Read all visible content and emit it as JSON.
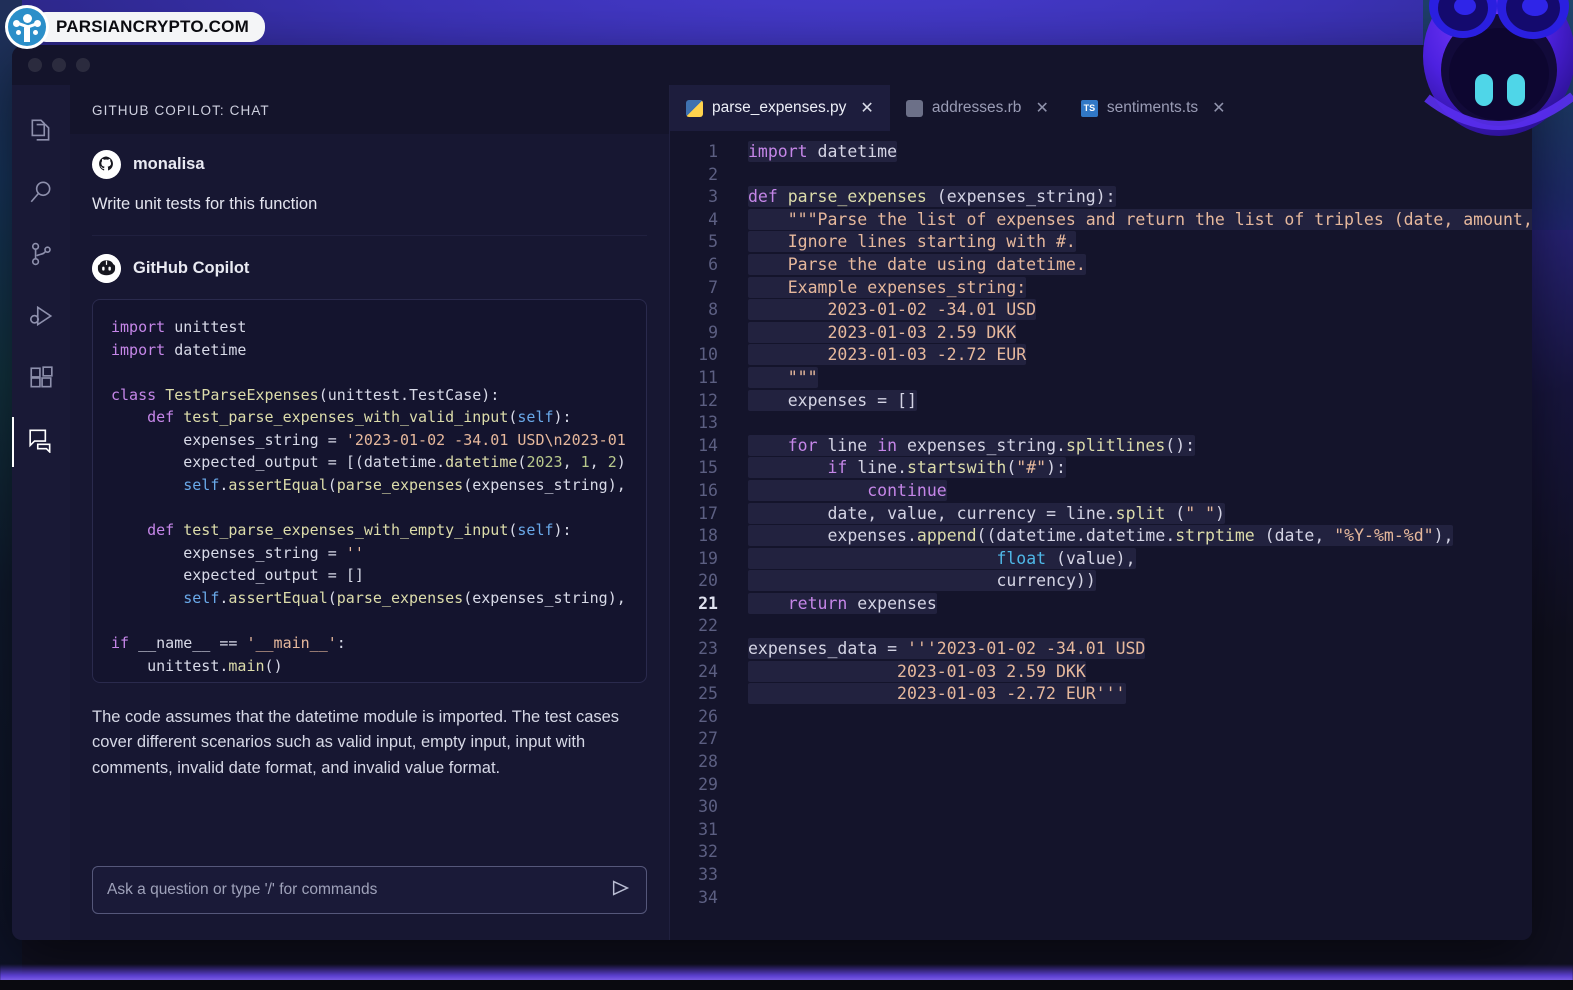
{
  "watermark": {
    "text": "PARSIANCRYPTO.COM",
    "logo_icon": "tree-network-logo-icon"
  },
  "window": {
    "traffic_lights": [
      "close",
      "minimize",
      "maximize"
    ]
  },
  "activity_bar": {
    "items": [
      {
        "name": "explorer",
        "icon": "files-icon",
        "active": false
      },
      {
        "name": "search",
        "icon": "search-icon",
        "active": false
      },
      {
        "name": "source-control",
        "icon": "source-control-icon",
        "active": false
      },
      {
        "name": "run-and-debug",
        "icon": "run-debug-icon",
        "active": false
      },
      {
        "name": "extensions",
        "icon": "extensions-icon",
        "active": false
      },
      {
        "name": "copilot-chat",
        "icon": "chat-icon",
        "active": true
      }
    ]
  },
  "chat": {
    "header": "GITHUB COPILOT: CHAT",
    "user_message": {
      "author": "monalisa",
      "avatar_icon": "octocat-avatar-icon",
      "text": "Write unit tests for this function"
    },
    "bot_message": {
      "author": "GitHub Copilot",
      "avatar_icon": "copilot-avatar-icon",
      "explanation": "The code assumes that the datetime module is imported. The test cases cover different scenarios such as valid input, empty input, input with comments, invalid date format, and invalid value format."
    },
    "code_block_lines": [
      "import unittest",
      "import datetime",
      "",
      "class TestParseExpenses(unittest.TestCase):",
      "    def test_parse_expenses_with_valid_input(self):",
      "        expenses_string = '2023-01-02 -34.01 USD\\n2023-01",
      "        expected_output = [(datetime.datetime(2023, 1, 2)",
      "        self.assertEqual(parse_expenses(expenses_string),",
      "",
      "    def test_parse_expenses_with_empty_input(self):",
      "        expenses_string = ''",
      "        expected_output = []",
      "        self.assertEqual(parse_expenses(expenses_string),",
      "",
      "if __name__ == '__main__':",
      "    unittest.main()"
    ],
    "input": {
      "placeholder": "Ask a question or type '/' for commands",
      "value": "",
      "send_icon": "send-icon"
    }
  },
  "editor": {
    "tabs": [
      {
        "label": "parse_expenses.py",
        "icon": "python-file-icon",
        "active": true,
        "close_icon": "close-icon"
      },
      {
        "label": "addresses.rb",
        "icon": "ruby-file-icon",
        "active": false,
        "close_icon": "close-icon"
      },
      {
        "label": "sentiments.ts",
        "icon": "typescript-file-icon",
        "active": false,
        "close_icon": "close-icon"
      }
    ],
    "active_line": 21,
    "line_numbers": [
      1,
      2,
      3,
      4,
      5,
      6,
      7,
      8,
      9,
      10,
      11,
      12,
      13,
      14,
      15,
      16,
      17,
      18,
      19,
      20,
      21,
      22,
      23,
      24,
      25,
      26,
      27,
      28,
      29,
      30,
      31,
      32,
      33,
      34
    ],
    "code_lines": [
      "import datetime",
      "",
      "def parse_expenses (expenses_string):",
      "    \"\"\"Parse the list of expenses and return the list of triples (date, amount, currency",
      "    Ignore lines starting with #.",
      "    Parse the date using datetime.",
      "    Example expenses_string:",
      "        2023-01-02 -34.01 USD",
      "        2023-01-03 2.59 DKK",
      "        2023-01-03 -2.72 EUR",
      "    \"\"\"",
      "    expenses = []",
      "",
      "    for line in expenses_string.splitlines():",
      "        if line.startswith(\"#\"):",
      "            continue",
      "        date, value, currency = line.split (\" \")",
      "        expenses.append((datetime.datetime.strptime (date, \"%Y-%m-%d\"),",
      "                         float (value),",
      "                         currency))",
      "    return expenses",
      "",
      "expenses_data = '''2023-01-02 -34.01 USD",
      "               2023-01-03 2.59 DKK",
      "               2023-01-03 -2.72 EUR'''",
      "",
      "",
      "",
      "",
      "",
      "",
      "",
      "",
      ""
    ]
  },
  "colors": {
    "window_bg": "#14142b",
    "chat_bg": "#171732",
    "activity_bar_bg": "#191936",
    "accent_purple": "#8e6df0",
    "tab_active_bg": "#1d1d3d",
    "line_highlight": "#22223f"
  }
}
